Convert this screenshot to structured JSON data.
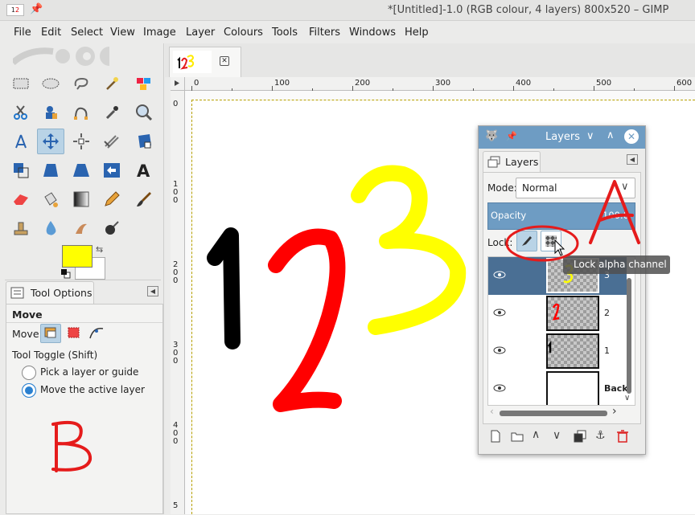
{
  "window": {
    "title": "*[Untitled]-1.0 (RGB colour, 4 layers) 800x520 – GIMP"
  },
  "menubar": {
    "items": [
      "File",
      "Edit",
      "Select",
      "View",
      "Image",
      "Layer",
      "Colours",
      "Tools",
      "Filters",
      "Windows",
      "Help"
    ]
  },
  "image_tab": {
    "thumb_text": "123"
  },
  "rulers": {
    "horizontal": [
      "0",
      "100",
      "200",
      "300",
      "400",
      "500",
      "600"
    ],
    "vertical": [
      [
        "0"
      ],
      [
        "1",
        "0",
        "0"
      ],
      [
        "2",
        "0",
        "0"
      ],
      [
        "3",
        "0",
        "0"
      ],
      [
        "4",
        "0",
        "0"
      ],
      [
        "5"
      ]
    ]
  },
  "tool_options": {
    "tab_label": "Tool Options",
    "tool_name": "Move",
    "move_label": "Move:",
    "toggle_label": "Tool Toggle  (Shift)",
    "options": [
      {
        "label": "Pick a layer or guide",
        "selected": false
      },
      {
        "label": "Move the active layer",
        "selected": true
      }
    ]
  },
  "colors": {
    "foreground": "#ffff00",
    "background": "#ffffff",
    "accent": "#6e9cc3",
    "selection": "#4a6f94"
  },
  "layers_dialog": {
    "title": "Layers",
    "tab_label": "Layers",
    "mode_label": "Mode:",
    "mode_value": "Normal",
    "opacity_label": "Opacity",
    "opacity_value": "100.0",
    "lock_label": "Lock:",
    "tooltip": "Lock alpha channel",
    "layers": [
      {
        "name": "3",
        "visible": true,
        "selected": true
      },
      {
        "name": "2",
        "visible": true,
        "selected": false
      },
      {
        "name": "1",
        "visible": true,
        "selected": false
      },
      {
        "name": "Background",
        "visible": true,
        "selected": false
      }
    ]
  },
  "annotations": {
    "a": "A",
    "b": "B"
  }
}
